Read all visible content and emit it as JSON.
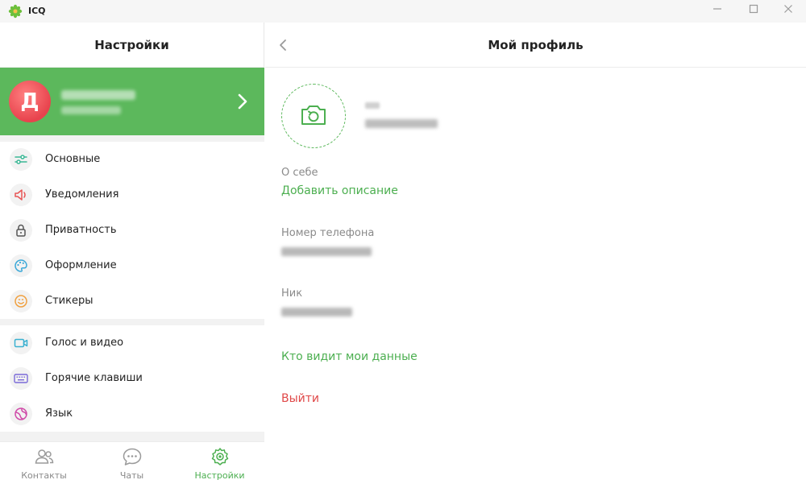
{
  "window": {
    "app_name": "ICQ",
    "controls": [
      "minimize",
      "maximize",
      "close"
    ]
  },
  "settings_panel": {
    "title": "Настройки",
    "profile_card": {
      "avatar_letter": "Д",
      "name": "[blurred]",
      "subtitle": "[blurred]"
    },
    "groups": [
      {
        "items": [
          {
            "label": "Основные",
            "icon": "sliders-icon",
            "color": "#3ab795"
          },
          {
            "label": "Уведомления",
            "icon": "speaker-icon",
            "color": "#e85454"
          },
          {
            "label": "Приватность",
            "icon": "lock-icon",
            "color": "#555555"
          },
          {
            "label": "Оформление",
            "icon": "palette-icon",
            "color": "#3aa8d8"
          },
          {
            "label": "Стикеры",
            "icon": "smile-icon",
            "color": "#f0a040"
          }
        ]
      },
      {
        "items": [
          {
            "label": "Голос и видео",
            "icon": "video-camera-icon",
            "color": "#3ab0d0"
          },
          {
            "label": "Горячие клавиши",
            "icon": "keyboard-icon",
            "color": "#7a6ad8"
          },
          {
            "label": "Язык",
            "icon": "globe-icon",
            "color": "#d04aa8"
          }
        ]
      }
    ],
    "bottom_tabs": [
      {
        "label": "Контакты",
        "icon": "contacts-icon",
        "active": false
      },
      {
        "label": "Чаты",
        "icon": "chat-bubble-icon",
        "active": false
      },
      {
        "label": "Настройки",
        "icon": "settings-gear-icon",
        "active": true
      }
    ]
  },
  "profile_panel": {
    "title": "Мой профиль",
    "name_label": "[blurred]",
    "name_value": "[blurred]",
    "about_label": "О себе",
    "about_action": "Добавить описание",
    "phone_label": "Номер телефона",
    "phone_value": "[blurred]",
    "nick_label": "Ник",
    "nick_value": "[blurred]",
    "privacy_link": "Кто видит мои данные",
    "logout": "Выйти"
  },
  "colors": {
    "accent_green": "#5cb85c",
    "link_green": "#4caf50",
    "logout_red": "#e04848",
    "avatar_red": "#e8434d"
  }
}
